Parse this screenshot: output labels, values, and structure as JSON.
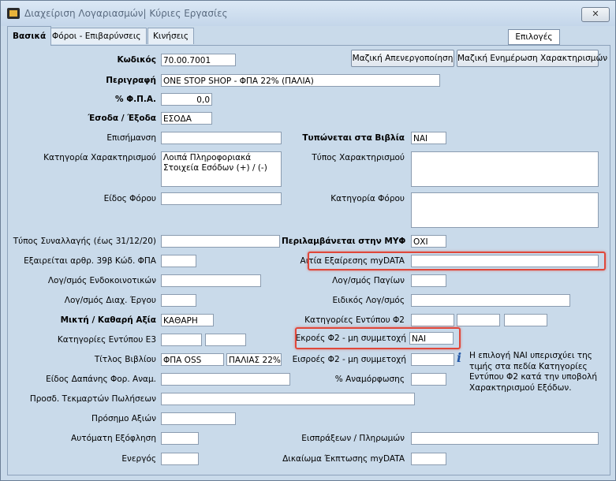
{
  "window": {
    "title": "Διαχείριση Λογαριασμών| Κύριες Εργασίες",
    "close_glyph": "✕"
  },
  "tabs": [
    "Βασικά",
    "Φόροι - Επιβαρύνσεις",
    "Κινήσεις"
  ],
  "options_label": "Επιλογές",
  "buttons": {
    "mass_deactivate": "Μαζική Απενεργοποίηση",
    "mass_update": "Μαζική Ενημέρωση Χαρακτηρισμών"
  },
  "labels": {
    "code": "Κωδικός",
    "description": "Περιγραφή",
    "vat": "% Φ.Π.Α.",
    "in_out": "Έσοδα / Έξοδα",
    "notation": "Επισήμανση",
    "printed_books": "Τυπώνεται στα Βιβλία",
    "characterization_category": "Κατηγορία Χαρακτηρισμού",
    "characterization_type": "Τύπος Χαρακτηρισμού",
    "tax_kind": "Είδος Φόρου",
    "tax_category": "Κατηγορία Φόρου",
    "transaction_type": "Τύπος Συναλλαγής (έως 31/12/20)",
    "included_myf": "Περιλαμβάνεται στην ΜΥΦ",
    "exempt_39b": "Εξαιρείται αρθρ. 39β Κώδ. ΦΠΑ",
    "exemption_reason": "Αιτία Εξαίρεσης myDATA",
    "intracommunity_account": "Λογ/σμός Ενδοκοινοτικών",
    "fixed_assets_account": "Λογ/σμός Παγίων",
    "project_management_account": "Λογ/σμός Διαχ. Έργου",
    "special_account": "Ειδικός Λογ/σμός",
    "net_value": "Μικτή / Καθαρή Αξία",
    "f2_categories": "Κατηγορίες Εντύπου Φ2",
    "e3_categories": "Κατηγορίες Εντύπου Ε3",
    "f2_outflows": "Εκροές Φ2 - μη συμμετοχή",
    "book_title": "Τίτλος Βιβλίου",
    "f2_inflows": "Εισροές Φ2 - μη συμμετοχή",
    "expense_kind": "Είδος Δαπάνης Φορ. Αναμ.",
    "revaluation": "% Αναμόρφωσης",
    "sales_documents": "Προσδ. Τεκμαρτών Πωλήσεων",
    "value_sign": "Πρόσημο Αξιών",
    "auto_settlement": "Αυτόματη Εξόφληση",
    "collections_payments": "Εισπράξεων / Πληρωμών",
    "active": "Ενεργός",
    "deduction_right": "Δικαίωμα Έκπτωσης myDATA"
  },
  "values": {
    "code": "70.00.7001",
    "description": "ONE STOP SHOP -  ΦΠΑ 22% (ΠΑΛΙΑ)",
    "vat": "0,0",
    "in_out": "ΕΣΟΔΑ",
    "printed_books": "ΝΑΙ",
    "characterization_category": "Λοιπά Πληροφοριακά Στοιχεία Εσόδων (+) / (-)",
    "included_myf": "ΟΧΙ",
    "net_value": "ΚΑΘΑΡΗ",
    "f2_outflows": "ΝΑΙ",
    "book_title_1": "ΦΠΑ OSS",
    "book_title_2": "ΠΑΛΙΑΣ 22%"
  },
  "info": {
    "icon": "info-icon",
    "glyph": "i",
    "text": "Η επιλογή ΝΑΙ υπερισχύει της τιμής στα πεδία Κατηγορίες Εντύπου Φ2 κατά την υποβολή Χαρακτηρισμού Εξόδων."
  }
}
